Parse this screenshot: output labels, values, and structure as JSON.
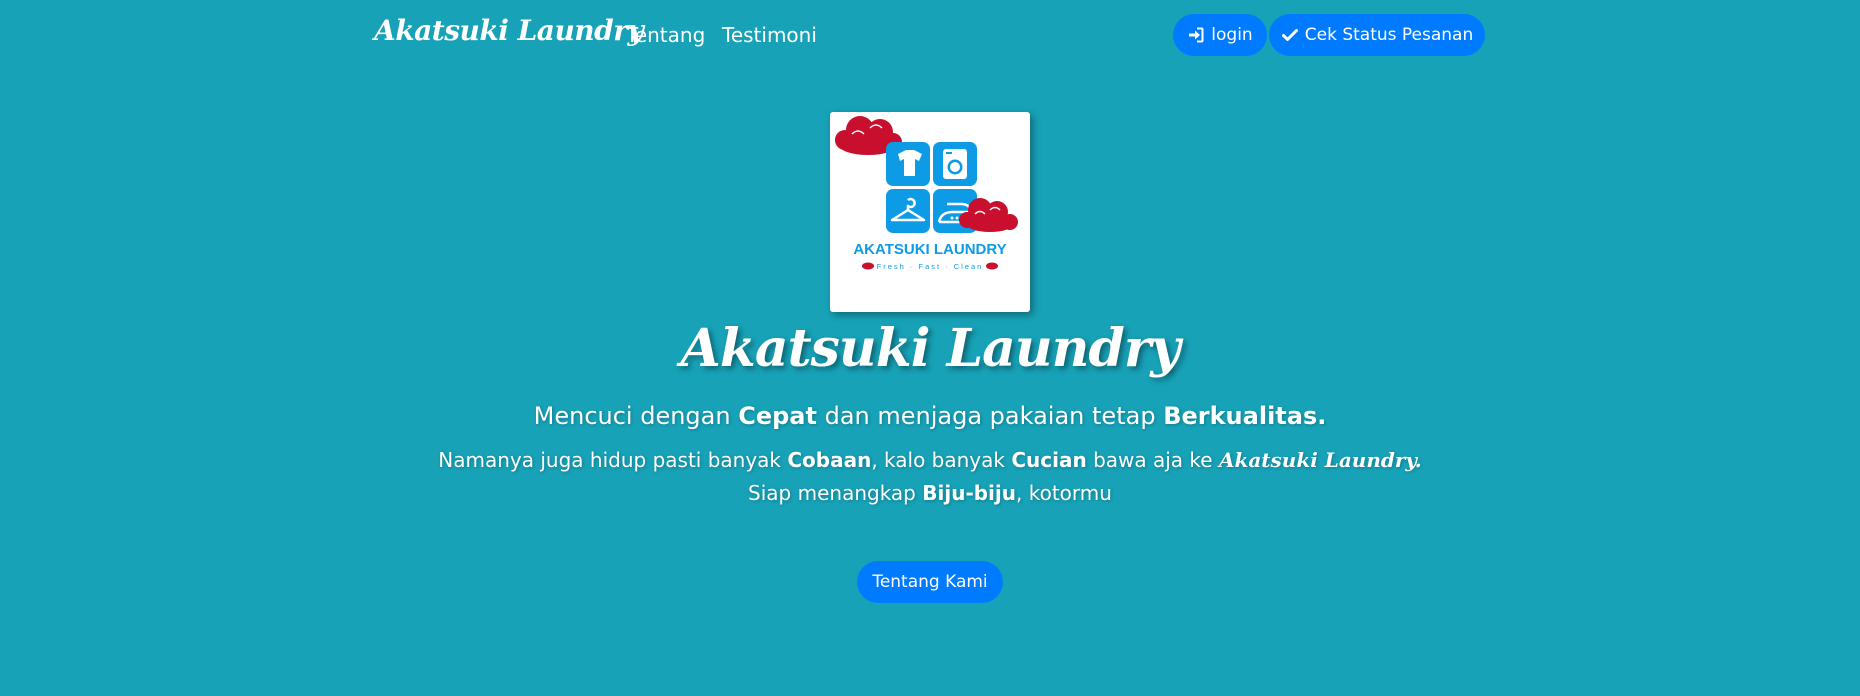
{
  "nav": {
    "brand": "Akatsuki Laundry",
    "links": [
      {
        "label": "Tentang"
      },
      {
        "label": "Testimoni"
      }
    ],
    "login_label": "login",
    "status_label": "Cek Status Pesanan",
    "login_icon": "sign-in-icon",
    "status_icon": "check-icon"
  },
  "logo": {
    "title": "AKATSUKI LAUNDRY",
    "subtitle": "Fresh · Fast · Clean",
    "icons": [
      "t-shirt-icon",
      "washing-machine-icon",
      "hanger-icon",
      "iron-icon",
      "cloud-icon"
    ]
  },
  "hero": {
    "title": "Akatsuki Laundry",
    "tagline": {
      "p1": "Mencuci dengan ",
      "b1": "Cepat",
      "p2": " dan menjaga pakaian tetap ",
      "b2": "Berkualitas."
    },
    "desc1": {
      "p1": "Namanya juga hidup pasti banyak ",
      "b1": "Cobaan",
      "p2": ", kalo banyak ",
      "b2": "Cucian",
      "p3": " bawa aja ke ",
      "brand": "Akatsuki Laundry."
    },
    "desc2": {
      "p1": "Siap menangkap ",
      "b1": "Biju-biju",
      "p2": ", kotormu"
    },
    "cta_label": "Tentang Kami"
  },
  "colors": {
    "background": "#17a2b8",
    "primary": "#007bff",
    "logo_blue": "#0d9be6",
    "cloud_red": "#c8102e"
  }
}
